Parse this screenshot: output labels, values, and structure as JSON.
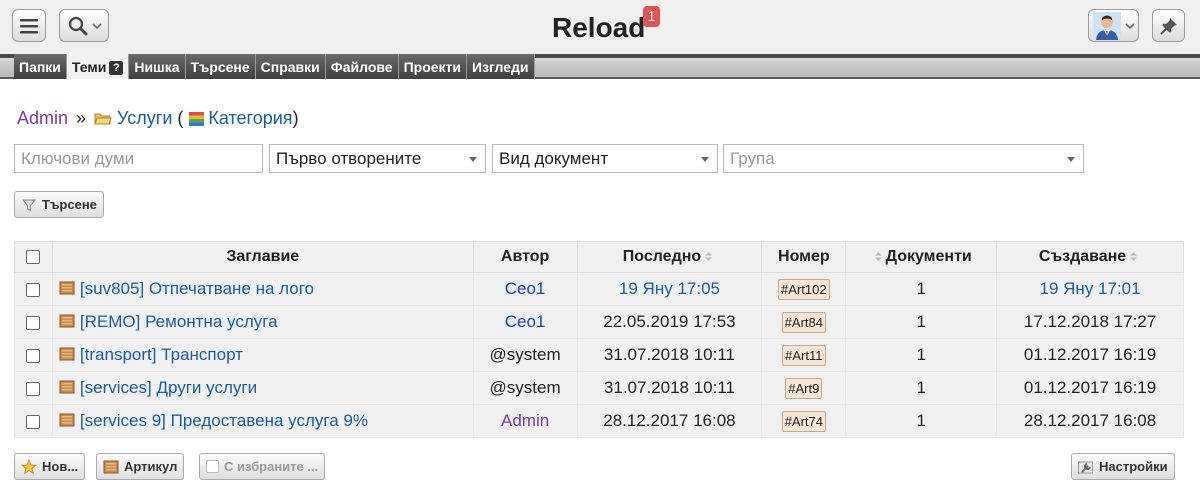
{
  "header": {
    "app_title": "Reload",
    "notification_count": "1"
  },
  "nav": {
    "tabs": [
      {
        "label": "Папки"
      },
      {
        "label": "Теми"
      },
      {
        "label": "Нишка"
      },
      {
        "label": "Търсене"
      },
      {
        "label": "Справки"
      },
      {
        "label": "Файлове"
      },
      {
        "label": "Проекти"
      },
      {
        "label": "Изгледи"
      }
    ],
    "help_mark": "?"
  },
  "breadcrumb": {
    "root": "Admin",
    "separator": "»",
    "folder": "Услуги",
    "open_paren": "(",
    "category": "Категория",
    "close_paren": ")"
  },
  "filters": {
    "keywords_placeholder": "Ключови думи",
    "order_value": "Първо отворените",
    "doc_type_value": "Вид документ",
    "group_placeholder": "Група",
    "search_button": "Търсене"
  },
  "table": {
    "columns": {
      "title": "Заглавие",
      "author": "Автор",
      "last": "Последно",
      "number": "Номер",
      "documents": "Документи",
      "created": "Създаване"
    },
    "rows": [
      {
        "title": "[suv805] Отпечатване на лого",
        "author": "Ceo1",
        "last": "19 Яну 17:05",
        "number": "#Art102",
        "documents": "1",
        "created": "19 Яну 17:01"
      },
      {
        "title": "[REMO] Ремонтна услуга",
        "author": "Ceo1",
        "last": "22.05.2019 17:53",
        "number": "#Art84",
        "documents": "1",
        "created": "17.12.2018 17:27"
      },
      {
        "title": "[transport] Транспорт",
        "author": "@system",
        "last": "31.07.2018 10:11",
        "number": "#Art11",
        "documents": "1",
        "created": "01.12.2017 16:19"
      },
      {
        "title": "[services] Други услуги",
        "author": "@system",
        "last": "31.07.2018 10:11",
        "number": "#Art9",
        "documents": "1",
        "created": "01.12.2017 16:19"
      },
      {
        "title": "[services 9] Предоставена услуга 9%",
        "author": "Admin",
        "last": "28.12.2017 16:08",
        "number": "#Art74",
        "documents": "1",
        "created": "28.12.2017 16:08"
      }
    ]
  },
  "footer": {
    "new_button": "Нов...",
    "article_button": "Артикул",
    "selected_button": "С избраните ...",
    "settings_button": "Настройки"
  }
}
